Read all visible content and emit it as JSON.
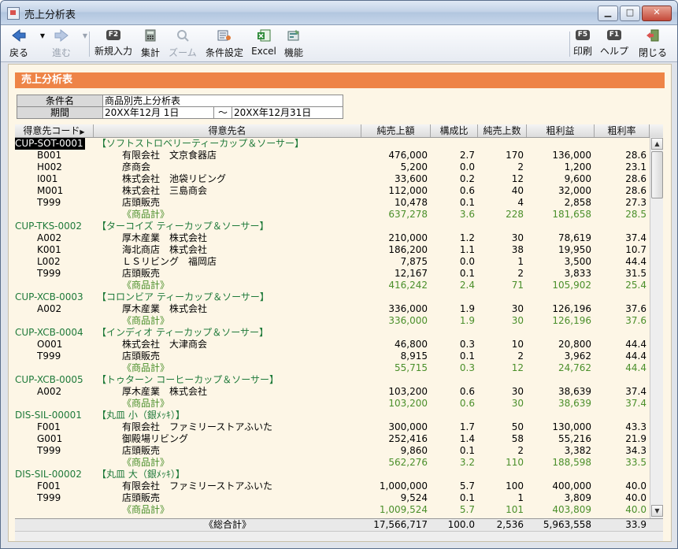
{
  "window": {
    "title": "売上分析表",
    "minimize": "▁",
    "maximize": "□",
    "close": "✕"
  },
  "toolbar": {
    "back": "戻る",
    "forward": "進む",
    "new": "新規入力",
    "new_key": "F2",
    "aggregate": "集計",
    "zoom": "ズーム",
    "conditions": "条件設定",
    "excel": "Excel",
    "functions": "機能",
    "print": "印刷",
    "print_key": "F5",
    "help": "ヘルプ",
    "help_key": "F1",
    "close": "閉じる"
  },
  "report": {
    "header": "売上分析表",
    "cond_label": "条件名",
    "cond_value": "商品別売上分析表",
    "period_label": "期間",
    "period_from": "20XX年12月 1日",
    "period_sep": "～",
    "period_to": "20XX年12月31日"
  },
  "columns": [
    "得意先コード",
    "得意先名",
    "純売上額",
    "構成比",
    "純売上数",
    "粗利益",
    "粗利率"
  ],
  "rows": [
    {
      "type": "product",
      "code": "CUP-SOT-0001",
      "name": "【ソフトストロベリーティーカップ＆ソーサー】",
      "selected": true
    },
    {
      "type": "detail",
      "code": "B001",
      "name": "有限会社　文京食器店",
      "amount": "476,000",
      "ratio": "2.7",
      "qty": "170",
      "gross": "136,000",
      "rate": "28.6"
    },
    {
      "type": "detail",
      "code": "H002",
      "name": "彦商会",
      "amount": "5,200",
      "ratio": "0.0",
      "qty": "2",
      "gross": "1,200",
      "rate": "23.1"
    },
    {
      "type": "detail",
      "code": "I001",
      "name": "株式会社　池袋リビング",
      "amount": "33,600",
      "ratio": "0.2",
      "qty": "12",
      "gross": "9,600",
      "rate": "28.6"
    },
    {
      "type": "detail",
      "code": "M001",
      "name": "株式会社　三島商会",
      "amount": "112,000",
      "ratio": "0.6",
      "qty": "40",
      "gross": "32,000",
      "rate": "28.6"
    },
    {
      "type": "detail",
      "code": "T999",
      "name": "店頭販売",
      "amount": "10,478",
      "ratio": "0.1",
      "qty": "4",
      "gross": "2,858",
      "rate": "27.3"
    },
    {
      "type": "subtotal",
      "code": "",
      "name": "《商品計》",
      "amount": "637,278",
      "ratio": "3.6",
      "qty": "228",
      "gross": "181,658",
      "rate": "28.5"
    },
    {
      "type": "product",
      "code": "CUP-TKS-0002",
      "name": "【ターコイズ ティーカップ＆ソーサー】"
    },
    {
      "type": "detail",
      "code": "A002",
      "name": "厚木産業　株式会社",
      "amount": "210,000",
      "ratio": "1.2",
      "qty": "30",
      "gross": "78,619",
      "rate": "37.4"
    },
    {
      "type": "detail",
      "code": "K001",
      "name": "海北商店　株式会社",
      "amount": "186,200",
      "ratio": "1.1",
      "qty": "38",
      "gross": "19,950",
      "rate": "10.7"
    },
    {
      "type": "detail",
      "code": "L002",
      "name": "ＬＳリビング　福岡店",
      "amount": "7,875",
      "ratio": "0.0",
      "qty": "1",
      "gross": "3,500",
      "rate": "44.4"
    },
    {
      "type": "detail",
      "code": "T999",
      "name": "店頭販売",
      "amount": "12,167",
      "ratio": "0.1",
      "qty": "2",
      "gross": "3,833",
      "rate": "31.5"
    },
    {
      "type": "subtotal",
      "code": "",
      "name": "《商品計》",
      "amount": "416,242",
      "ratio": "2.4",
      "qty": "71",
      "gross": "105,902",
      "rate": "25.4"
    },
    {
      "type": "product",
      "code": "CUP-XCB-0003",
      "name": "【コロンビア ティーカップ＆ソーサー】"
    },
    {
      "type": "detail",
      "code": "A002",
      "name": "厚木産業　株式会社",
      "amount": "336,000",
      "ratio": "1.9",
      "qty": "30",
      "gross": "126,196",
      "rate": "37.6"
    },
    {
      "type": "subtotal",
      "code": "",
      "name": "《商品計》",
      "amount": "336,000",
      "ratio": "1.9",
      "qty": "30",
      "gross": "126,196",
      "rate": "37.6"
    },
    {
      "type": "product",
      "code": "CUP-XCB-0004",
      "name": "【インディオ ティーカップ＆ソーサー】"
    },
    {
      "type": "detail",
      "code": "O001",
      "name": "株式会社　大津商会",
      "amount": "46,800",
      "ratio": "0.3",
      "qty": "10",
      "gross": "20,800",
      "rate": "44.4"
    },
    {
      "type": "detail",
      "code": "T999",
      "name": "店頭販売",
      "amount": "8,915",
      "ratio": "0.1",
      "qty": "2",
      "gross": "3,962",
      "rate": "44.4"
    },
    {
      "type": "subtotal",
      "code": "",
      "name": "《商品計》",
      "amount": "55,715",
      "ratio": "0.3",
      "qty": "12",
      "gross": "24,762",
      "rate": "44.4"
    },
    {
      "type": "product",
      "code": "CUP-XCB-0005",
      "name": "【トゥターン コーヒーカップ＆ソーサー】"
    },
    {
      "type": "detail",
      "code": "A002",
      "name": "厚木産業　株式会社",
      "amount": "103,200",
      "ratio": "0.6",
      "qty": "30",
      "gross": "38,639",
      "rate": "37.4"
    },
    {
      "type": "subtotal",
      "code": "",
      "name": "《商品計》",
      "amount": "103,200",
      "ratio": "0.6",
      "qty": "30",
      "gross": "38,639",
      "rate": "37.4"
    },
    {
      "type": "product",
      "code": "DIS-SIL-00001",
      "name": "【丸皿 小（銀ﾒｯｷ）】"
    },
    {
      "type": "detail",
      "code": "F001",
      "name": "有限会社　ファミリーストアふいた",
      "amount": "300,000",
      "ratio": "1.7",
      "qty": "50",
      "gross": "130,000",
      "rate": "43.3"
    },
    {
      "type": "detail",
      "code": "G001",
      "name": "御殿場リビング",
      "amount": "252,416",
      "ratio": "1.4",
      "qty": "58",
      "gross": "55,216",
      "rate": "21.9"
    },
    {
      "type": "detail",
      "code": "T999",
      "name": "店頭販売",
      "amount": "9,860",
      "ratio": "0.1",
      "qty": "2",
      "gross": "3,382",
      "rate": "34.3"
    },
    {
      "type": "subtotal",
      "code": "",
      "name": "《商品計》",
      "amount": "562,276",
      "ratio": "3.2",
      "qty": "110",
      "gross": "188,598",
      "rate": "33.5"
    },
    {
      "type": "product",
      "code": "DIS-SIL-00002",
      "name": "【丸皿 大（銀ﾒｯｷ）】"
    },
    {
      "type": "detail",
      "code": "F001",
      "name": "有限会社　ファミリーストアふいた",
      "amount": "1,000,000",
      "ratio": "5.7",
      "qty": "100",
      "gross": "400,000",
      "rate": "40.0"
    },
    {
      "type": "detail",
      "code": "T999",
      "name": "店頭販売",
      "amount": "9,524",
      "ratio": "0.1",
      "qty": "1",
      "gross": "3,809",
      "rate": "40.0"
    },
    {
      "type": "subtotal",
      "code": "",
      "name": "《商品計》",
      "amount": "1,009,524",
      "ratio": "5.7",
      "qty": "101",
      "gross": "403,809",
      "rate": "40.0"
    }
  ],
  "total": {
    "label": "《総合計》",
    "amount": "17,566,717",
    "ratio": "100.0",
    "qty": "2,536",
    "gross": "5,963,558",
    "rate": "33.9"
  },
  "icons": {
    "back": "back-arrow-icon",
    "forward": "forward-arrow-icon",
    "aggregate": "calculator-icon",
    "zoom": "zoom-icon",
    "conditions": "conditions-icon",
    "excel": "excel-icon",
    "functions": "functions-icon",
    "close": "exit-door-icon"
  },
  "colors": {
    "header_bar": "#ee8447",
    "content_bg": "#fdf6e6",
    "product_text": "#1f7a3a",
    "subtotal_text": "#4a8f2a"
  }
}
